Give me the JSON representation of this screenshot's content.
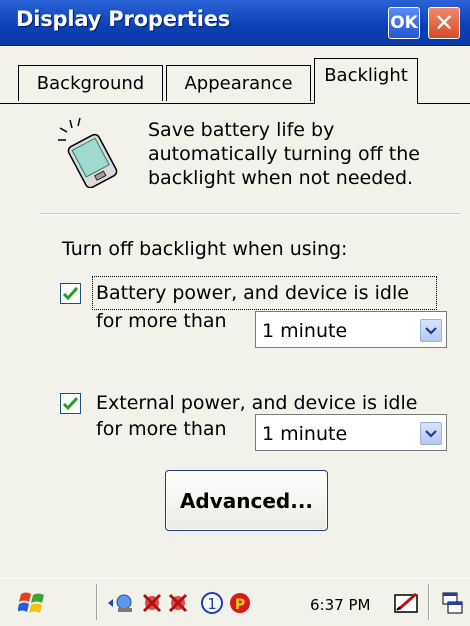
{
  "window": {
    "title": "Display Properties",
    "ok_label": "OK",
    "close_label": "✕"
  },
  "tabs": [
    {
      "label": "Background",
      "selected": false
    },
    {
      "label": "Appearance",
      "selected": false
    },
    {
      "label": "Backlight",
      "selected": true
    }
  ],
  "backlight": {
    "description": "Save battery life by\nautomatically turning off the\nbacklight when not needed.",
    "turn_off_label": "Turn off backlight when using:",
    "battery": {
      "checked": true,
      "label": "Battery power, and device is idle",
      "for_more_than": "for more than",
      "value": "1 minute"
    },
    "external": {
      "checked": true,
      "label": "External power, and device is idle",
      "for_more_than": "for more than",
      "value": "1 minute"
    },
    "advanced_label": "Advanced..."
  },
  "taskbar": {
    "clock": "6:37 PM"
  },
  "colors": {
    "titlebar": "#0b3fb6",
    "check": "#21a121",
    "panel": "#f2f1ea"
  }
}
